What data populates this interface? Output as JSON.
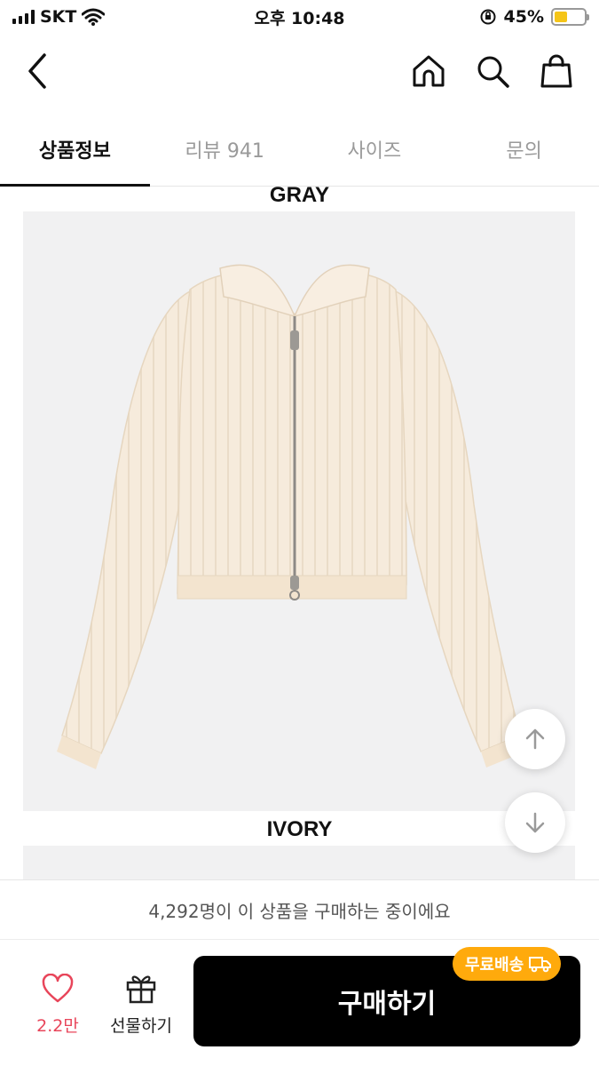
{
  "status_bar": {
    "carrier": "SKT",
    "time": "오후 10:48",
    "battery_text": "45%",
    "battery_level": 0.45,
    "battery_color": "#f5c518"
  },
  "nav": {
    "back_icon": "chevron-left-icon",
    "icons": [
      "home-icon",
      "search-icon",
      "shopping-bag-icon"
    ]
  },
  "tabs": [
    {
      "label": "상품정보",
      "active": true
    },
    {
      "label": "리뷰 941",
      "active": false
    },
    {
      "label": "사이즈",
      "active": false
    },
    {
      "label": "문의",
      "active": false
    }
  ],
  "content": {
    "color_labels": [
      "GRAY",
      "IVORY"
    ],
    "product_color": "#f6ebdc"
  },
  "scroll_buttons": [
    "arrow-up-icon",
    "arrow-down-icon"
  ],
  "buying_banner": "4,292명이 이 상품을 구매하는 중이에요",
  "bottom_bar": {
    "like_count": "2.2만",
    "gift_label": "선물하기",
    "buy_label": "구매하기",
    "shipping_badge": "무료배송",
    "accent_color": "#e8455a",
    "badge_color": "#ffaa0c"
  }
}
